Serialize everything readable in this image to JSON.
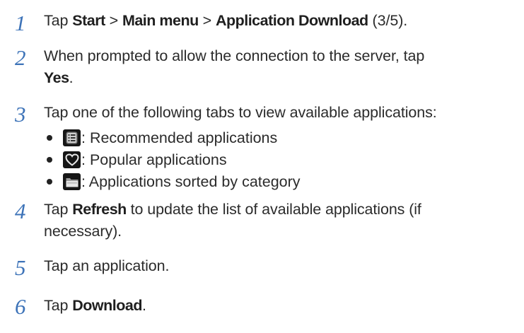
{
  "steps": [
    {
      "number": "1",
      "parts": [
        "Tap ",
        "Start",
        " > ",
        "Main menu",
        " > ",
        "Application Download",
        " (3/5)."
      ]
    },
    {
      "number": "2",
      "line1": "When prompted to allow the connection to the server, tap",
      "bold": "Yes",
      "suffix": "."
    },
    {
      "number": "3",
      "text": "Tap one of the following tabs to view available applications:",
      "bullets": [
        {
          "icon": "list-icon",
          "text": ": Recommended applications"
        },
        {
          "icon": "heart-icon",
          "text": ": Popular applications"
        },
        {
          "icon": "folder-icon",
          "text": ": Applications sorted by category"
        }
      ]
    },
    {
      "number": "4",
      "pre": "Tap ",
      "bold": "Refresh",
      "post1": " to update the list of available applications (if",
      "line2": "necessary)."
    },
    {
      "number": "5",
      "text": "Tap an application."
    },
    {
      "number": "6",
      "pre": "Tap ",
      "bold": "Download",
      "post": "."
    }
  ]
}
